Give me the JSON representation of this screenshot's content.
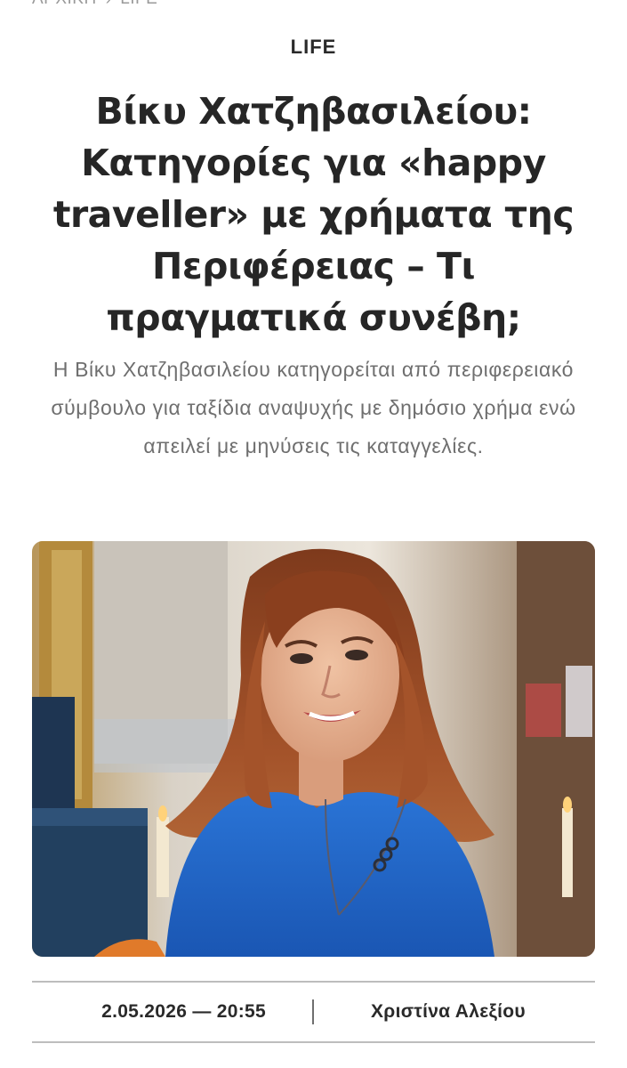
{
  "breadcrumb": {
    "home": "ΑΡΧΙΚΗ",
    "separator": "›",
    "current": "LIFE"
  },
  "article": {
    "category": "LIFE",
    "title": "Βίκυ Χατζηβασιλείου: Κατηγορίες για «happy traveller» με χρήματα της Περιφέρειας – Τι πραγματικά συνέβη;",
    "lead": "Η Βίκυ Χατζηβασιλείου κατηγορείται από περιφερειακό σύμβουλο για ταξίδια αναψυχής με δημόσιο χρήμα ενώ απειλεί με μηνύσεις τις καταγγελίες.",
    "date": "2.05.2026 — 20:55",
    "author": "Χριστίνα Αλεξίου"
  },
  "colors": {
    "dress": "#1f64c8",
    "hair": "#9a4a22",
    "skin": "#e7b596"
  }
}
